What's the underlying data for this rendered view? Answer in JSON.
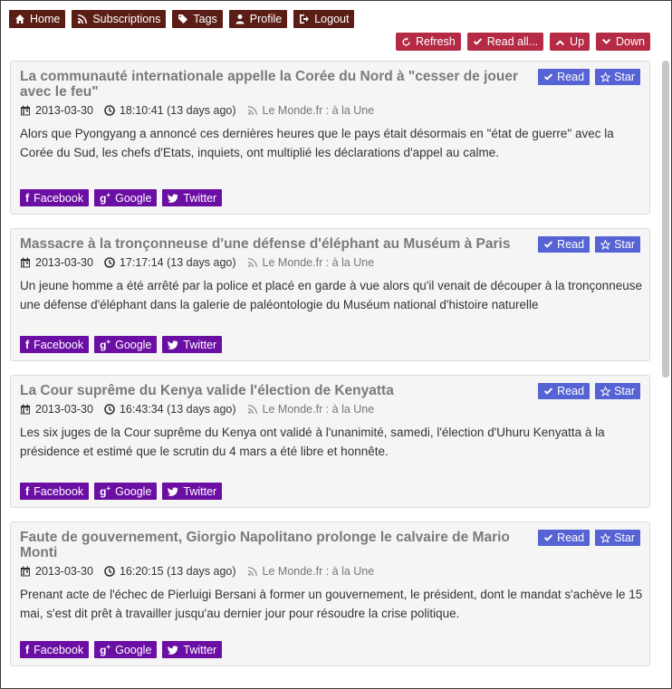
{
  "nav": {
    "home": "Home",
    "subscriptions": "Subscriptions",
    "tags": "Tags",
    "profile": "Profile",
    "logout": "Logout"
  },
  "actions": {
    "refresh": "Refresh",
    "read_all": "Read all...",
    "up": "Up",
    "down": "Down"
  },
  "labels": {
    "read": "Read",
    "star": "Star",
    "facebook": "Facebook",
    "google": "Google",
    "twitter": "Twitter"
  },
  "colors": {
    "nav_bg": "#5b1e16",
    "action_bg": "#b52a45",
    "read_star_bg": "#5663d4",
    "share_bg": "#6b0ea3",
    "card_bg": "#f5f5f5"
  },
  "articles": [
    {
      "title": "La communauté internationale appelle la Corée du Nord à \"cesser de jouer avec le feu\"",
      "date": "2013-03-30",
      "time": "18:10:41 (13 days ago)",
      "feed": "Le Monde.fr : à la Une",
      "summary": "Alors que Pyongyang a annoncé ces dernières heures que le pays était désormais en \"état de guerre\" avec la Corée du Sud, les chefs d'Etats, inquiets, ont multiplié les déclarations d'appel au calme."
    },
    {
      "title": "Massacre à la tronçonneuse d'une défense d'éléphant au Muséum à Paris",
      "date": "2013-03-30",
      "time": "17:17:14 (13 days ago)",
      "feed": "Le Monde.fr : à la Une",
      "summary": "Un jeune homme a été arrêté par la police et placé en garde à vue alors qu'il venait de découper à la tronçonneuse une défense d'éléphant dans la galerie de paléontologie du Muséum national d'histoire naturelle"
    },
    {
      "title": "La Cour suprême du Kenya valide l'élection de Kenyatta",
      "date": "2013-03-30",
      "time": "16:43:34 (13 days ago)",
      "feed": "Le Monde.fr : à la Une",
      "summary": "Les six juges de la Cour suprême du Kenya ont validé à l'unanimité, samedi, l'élection d'Uhuru Kenyatta à la présidence et estimé que le scrutin du 4 mars a été libre et honnête."
    },
    {
      "title": "Faute de gouvernement, Giorgio Napolitano prolonge le calvaire de Mario Monti",
      "date": "2013-03-30",
      "time": "16:20:15 (13 days ago)",
      "feed": "Le Monde.fr : à la Une",
      "summary": "Prenant acte de l'échec de Pierluigi Bersani à former un gouvernement, le président, dont le mandat s'achève le 15 mai, s'est dit prêt à travailler jusqu'au dernier jour pour résoudre la crise politique."
    }
  ]
}
